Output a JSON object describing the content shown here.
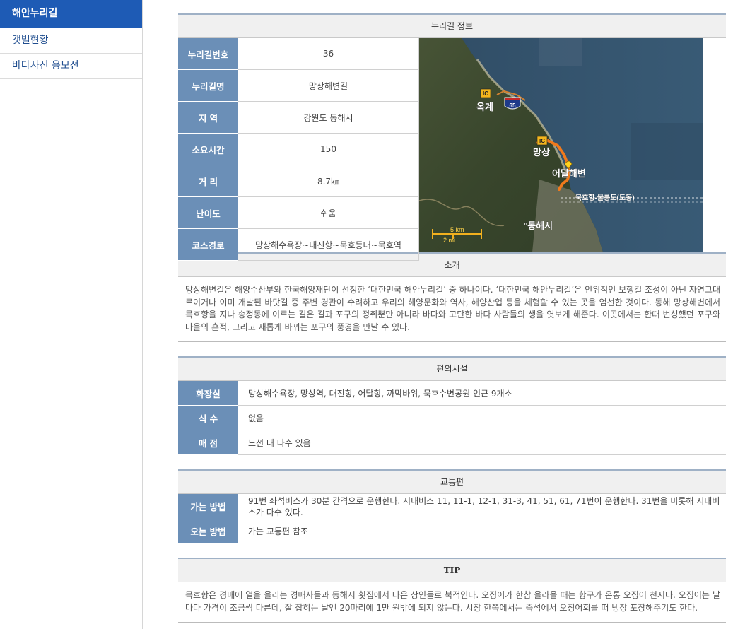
{
  "sidebar": {
    "items": [
      {
        "label": "해안누리길",
        "active": true
      },
      {
        "label": "갯벌현황",
        "active": false
      },
      {
        "label": "바다사진 응모전",
        "active": false
      }
    ]
  },
  "info": {
    "title": "누리길 정보",
    "rows": [
      {
        "label": "누리길번호",
        "value": "36"
      },
      {
        "label": "누리길명",
        "value": "망상해변길"
      },
      {
        "label": "지 역",
        "value": "강원도 동해시"
      },
      {
        "label": "소요시간",
        "value": "150"
      },
      {
        "label": "거 리",
        "value": "8.7㎞"
      },
      {
        "label": "난이도",
        "value": "쉬움"
      },
      {
        "label": "코스경로",
        "value": "망상해수욕장~대진항~묵호등대~묵호역"
      }
    ],
    "map": {
      "labels": [
        "옥계",
        "망상",
        "어달해변",
        "묵호항-울릉도(도동)",
        "°동해시"
      ],
      "ic_label": "IC",
      "highway_number": "65",
      "scale": {
        "km": "5 km",
        "mi": "2 mi"
      },
      "colors": {
        "route": "#f07a1c",
        "sea": "#32506a",
        "land": "#3c4a2e",
        "ic_badge": "#f4b61c"
      }
    }
  },
  "intro": {
    "title": "소개",
    "text": "망상해변길은 해양수산부와 한국해양재단이 선정한 ‘대한민국 해안누리길’ 중 하나이다. ‘대한민국 해안누리길’은 인위적인 보행길 조성이 아닌 자연그대로이거나 이미 개발된 바닷길 중 주변 경관이 수려하고 우리의 해양문화와 역사, 해양산업 등을 체험할 수 있는 곳을 엄선한 것이다. 동해 망상해변에서 묵호항을 지나 송정동에 이르는 길은 길과 포구의 정취뿐만 아니라 바다와 고단한 바다 사람들의 생을 엿보게 해준다. 이곳에서는 한때 번성했던 포구와 마을의 흔적, 그리고 새롭게 바뀌는 포구의 풍경을 만날 수 있다."
  },
  "facilities": {
    "title": "편의시설",
    "rows": [
      {
        "label": "화장실",
        "value": "망상해수욕장, 망상역, 대진항, 어달항, 까막바위, 묵호수변공원 인근 9개소"
      },
      {
        "label": "식 수",
        "value": "없음"
      },
      {
        "label": "매 점",
        "value": "노선 내 다수 있음"
      }
    ]
  },
  "transport": {
    "title": "교통편",
    "rows": [
      {
        "label": "가는 방법",
        "value": "91번 좌석버스가 30분 간격으로 운행한다. 시내버스 11, 11-1, 12-1, 31-3, 41, 51, 61, 71번이 운행한다. 31번을 비롯해 시내버스가 다수 있다."
      },
      {
        "label": "오는 방법",
        "value": "가는 교통편 참조"
      }
    ]
  },
  "tip": {
    "title": "TIP",
    "text": "묵호항은 경매에 열을 올리는 경매사들과 동해시 횟집에서 나온 상인들로 북적인다. 오징어가 한참 올라올 때는 항구가 온통 오징어 천지다. 오징어는 날마다 가격이 조금씩 다른데, 잘 잡히는 날엔 20마리에 1만 원밖에 되지 않는다. 시장 한쪽에서는 즉석에서 오징어회를 떠 냉장 포장해주기도 한다."
  }
}
